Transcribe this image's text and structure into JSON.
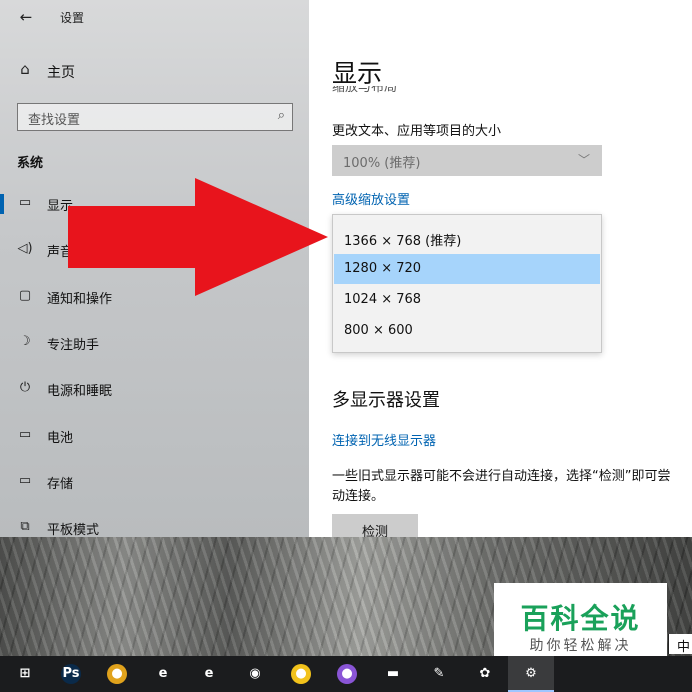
{
  "window": {
    "title": "设置",
    "back_icon": "back-arrow-icon",
    "back_glyph": "←",
    "minimize_glyph": "–"
  },
  "sidebar": {
    "home_label": "主页",
    "home_glyph": "⌂",
    "search_placeholder": "查找设置",
    "search_glyph": "⌕",
    "section_label": "系统",
    "items": [
      {
        "label": "显示",
        "icon": "monitor-icon",
        "glyph": "▭",
        "active": true
      },
      {
        "label": "声音",
        "icon": "speaker-icon",
        "glyph": "◁)",
        "active": false
      },
      {
        "label": "通知和操作",
        "icon": "notification-icon",
        "glyph": "▢",
        "active": false
      },
      {
        "label": "专注助手",
        "icon": "moon-icon",
        "glyph": "☽",
        "active": false
      },
      {
        "label": "电源和睡眠",
        "icon": "power-icon",
        "glyph": "⏻",
        "active": false
      },
      {
        "label": "电池",
        "icon": "battery-icon",
        "glyph": "▭",
        "active": false
      },
      {
        "label": "存储",
        "icon": "storage-icon",
        "glyph": "▭",
        "active": false
      },
      {
        "label": "平板模式",
        "icon": "tablet-icon",
        "glyph": "⧉",
        "active": false
      }
    ]
  },
  "main": {
    "page_title": "显示",
    "partial_text": "缩放与布局",
    "scale_label": "更改文本、应用等项目的大小",
    "scale_value": "100% (推荐)",
    "scale_chevron": "﹀",
    "advanced_scale_link": "高级缩放设置",
    "resolution_options": [
      {
        "label": "1366 × 768 (推荐)",
        "selected": false
      },
      {
        "label": "1280 × 720",
        "selected": true
      },
      {
        "label": "1024 × 768",
        "selected": false
      },
      {
        "label": "800 × 600",
        "selected": false
      }
    ],
    "multi_display_heading": "多显示器设置",
    "wireless_link": "连接到无线显示器",
    "detect_desc_line1": "一些旧式显示器可能不会进行自动连接，选择“检测”即可尝",
    "detect_desc_line2": "动连接。",
    "detect_button": "检测"
  },
  "annotation": {
    "arrow_color": "#e8141c"
  },
  "watermark": {
    "title": "百科全说",
    "subtitle": "助你轻松解决"
  },
  "ime": {
    "label": "中"
  },
  "taskbar": {
    "items": [
      {
        "name": "start-icon",
        "glyph": "⊞",
        "color": "transparent"
      },
      {
        "name": "photoshop-icon",
        "glyph": "Ps",
        "color": "#0a2a4a"
      },
      {
        "name": "chrome-icon",
        "glyph": "●",
        "color": "#e0a21c"
      },
      {
        "name": "ie-icon",
        "glyph": "e",
        "color": "transparent"
      },
      {
        "name": "edge-icon",
        "glyph": "e",
        "color": "transparent"
      },
      {
        "name": "qq-icon",
        "glyph": "◉",
        "color": "transparent"
      },
      {
        "name": "app-icon-green",
        "glyph": "●",
        "color": "#f2c21b"
      },
      {
        "name": "balloon-icon",
        "glyph": "●",
        "color": "#8a55d6"
      },
      {
        "name": "folder-icon",
        "glyph": "▬",
        "color": "transparent"
      },
      {
        "name": "broom-icon",
        "glyph": "✎",
        "color": "transparent"
      },
      {
        "name": "paint-icon",
        "glyph": "✿",
        "color": "transparent"
      },
      {
        "name": "settings-icon",
        "glyph": "⚙",
        "color": "transparent",
        "active": true
      }
    ]
  }
}
